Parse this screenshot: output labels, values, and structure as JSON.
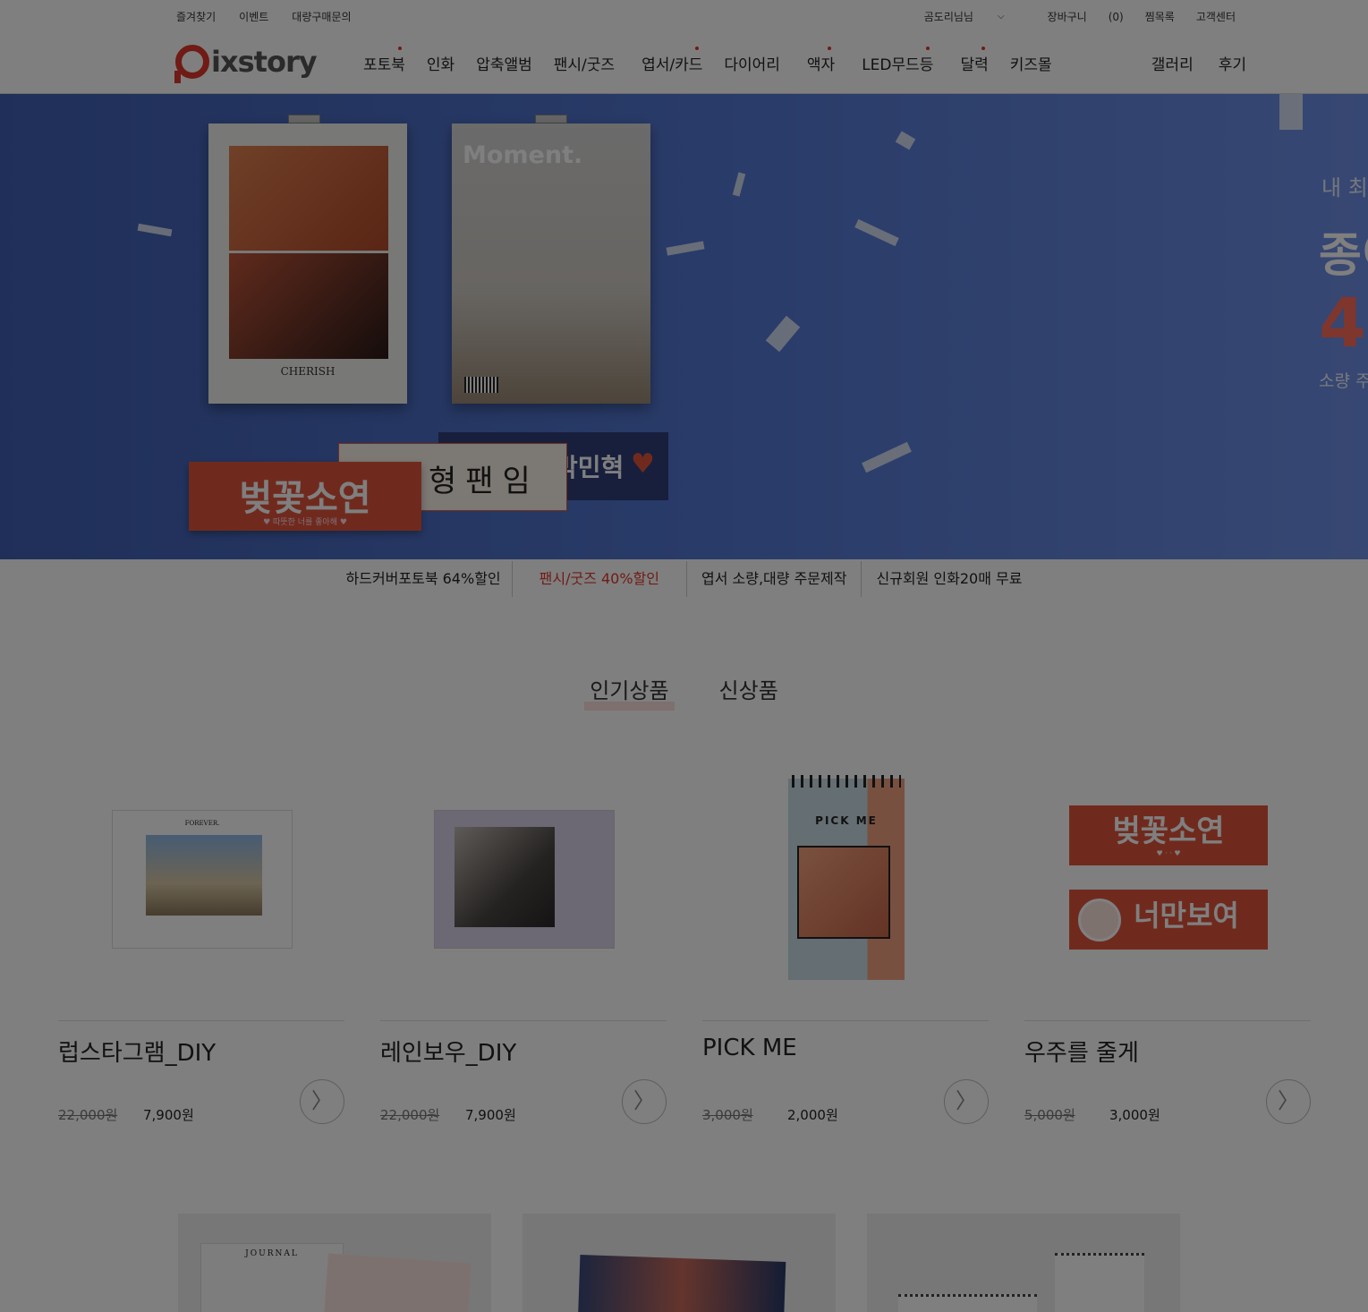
{
  "topbar": {
    "left": [
      "즐겨찾기",
      "이벤트",
      "대량구매문의"
    ],
    "user": "곰도리님님",
    "cart_label": "장바구니",
    "cart_count": "(0)",
    "wishlist": "찜목록",
    "support": "고객센터"
  },
  "logo": {
    "text": "ixstory"
  },
  "nav": {
    "items": [
      "포토북",
      "인화",
      "압축앨범",
      "팬시/굿즈",
      "엽서/카드",
      "다이어리",
      "액자",
      "LED무드등",
      "달력",
      "키즈몰"
    ],
    "right": [
      "갤러리",
      "후기"
    ]
  },
  "hero": {
    "poster1_caption": "CHERISH",
    "poster2_title": "Moment.",
    "slogan1": "벚꽃소연",
    "slogan1_sub": "♥ 따뜻한 너를 좋아해 ♥",
    "slogan2": "형팬임",
    "slogan3": "박민혁",
    "copy_line1": "내 최",
    "copy_line2": "종이",
    "copy_line3": "4",
    "copy_line4": "소량 주"
  },
  "promo": [
    "하드커버포토북 64%할인",
    "팬시/굿즈 40%할인",
    "엽서 소량,대량 주문제작",
    "신규회원 인화20매 무료"
  ],
  "tabs": [
    "인기상품",
    "신상품"
  ],
  "products": [
    {
      "name": "럽스타그램_DIY",
      "old_price": "22,000원",
      "price": "7,900원",
      "insta_top": "FOREVER."
    },
    {
      "name": "레인보우_DIY",
      "old_price": "22,000원",
      "price": "7,900원"
    },
    {
      "name": "PICK ME",
      "old_price": "3,000원",
      "price": "2,000원",
      "cover_text": "PICK  ME"
    },
    {
      "name": "우주를 줄게",
      "old_price": "5,000원",
      "price": "3,000원",
      "slogan_a": "벚꽃소연",
      "slogan_b": "너만보여"
    }
  ],
  "cards": [
    {
      "label": "JOURNAL"
    }
  ],
  "colors": {
    "accent": "#e0372a",
    "hero_bg": "#4a6bc4"
  }
}
